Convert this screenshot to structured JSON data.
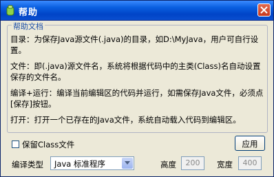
{
  "window": {
    "title": "帮助",
    "icons": {
      "app": "app-logo-icon",
      "close": "close-icon"
    }
  },
  "help": {
    "legend": "帮助文档",
    "paragraphs": [
      "目录：为保存Java源文件(.java)的目录，如D:\\MyJava，用户可自行设置。",
      "文件：即(.java)源文件名，系统将根据代码中的主类(Class)名自动设置保存的文件名。",
      "编译+运行：编译当前编辑区的代码并运行，如需保存Java文件，必须点[保存]按钮。",
      "打开：打开一个已存在的Java文件，系统自动载入代码到编辑区。"
    ]
  },
  "options": {
    "save_class_label": "保留Class文件",
    "save_class_checked": false,
    "apply_label": "应用"
  },
  "compile": {
    "type_label": "编译类型",
    "type_value": "Java 标准程序",
    "height_label": "高度",
    "height_value": "200",
    "width_label": "宽度",
    "width_value": "400"
  }
}
